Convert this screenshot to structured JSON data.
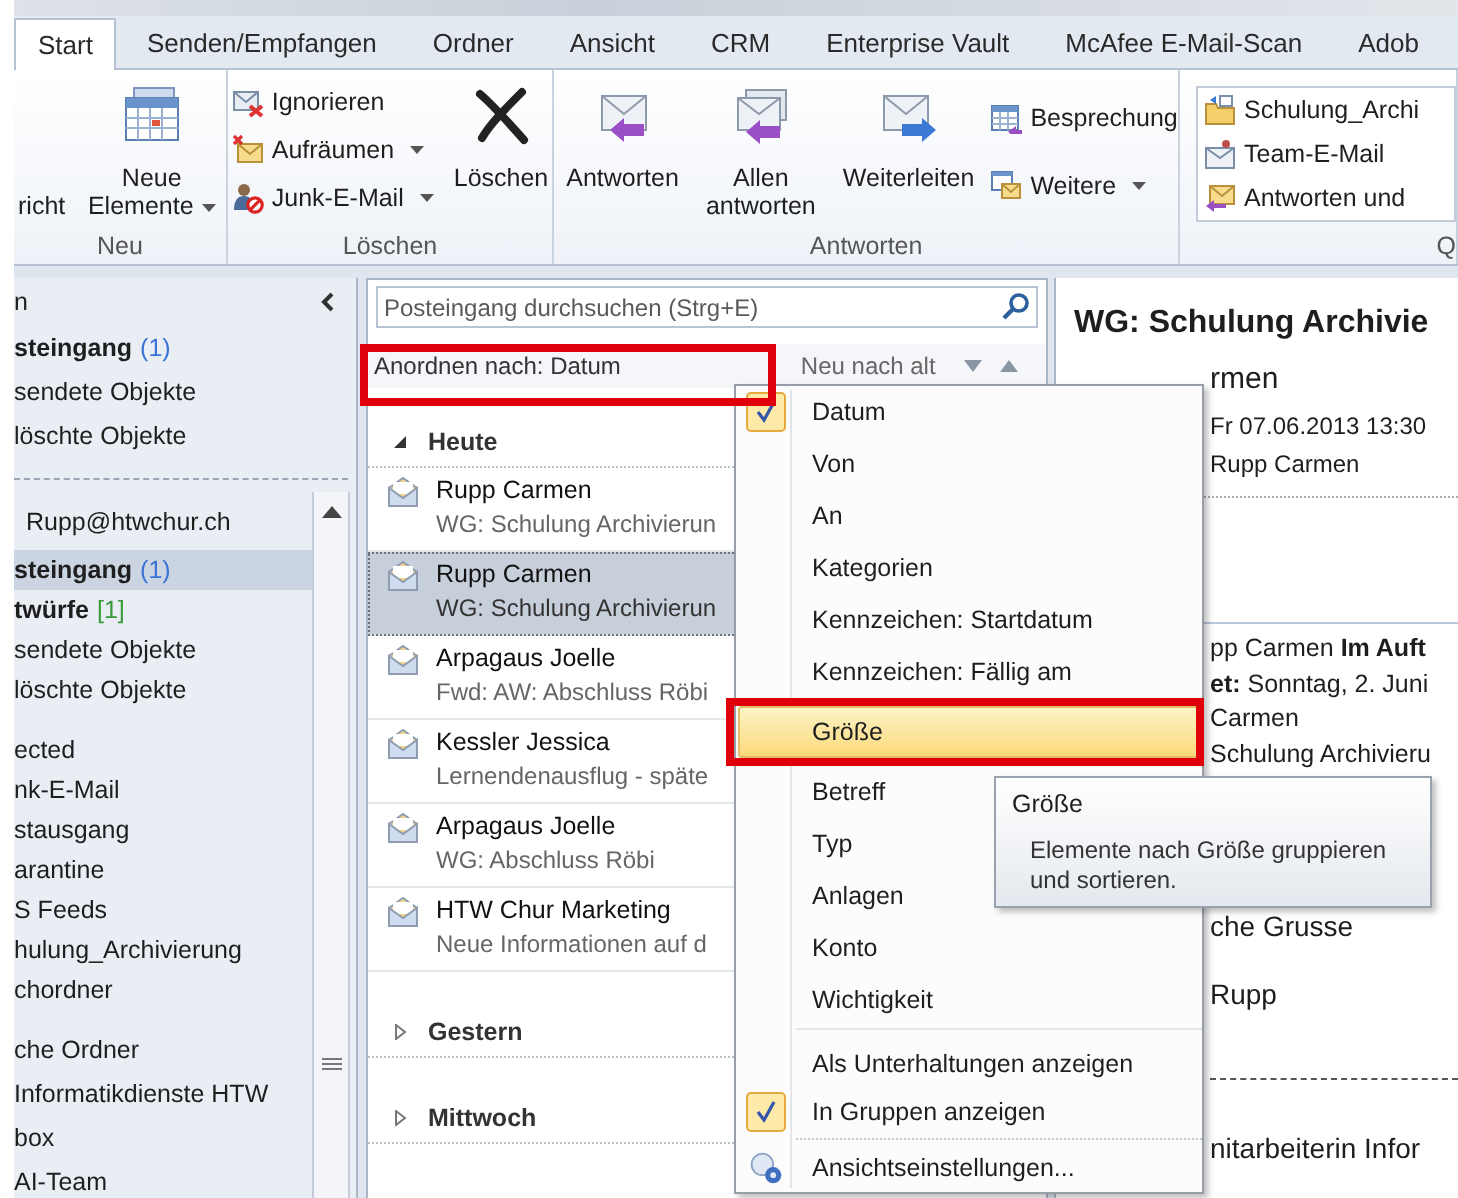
{
  "ribbon": {
    "tabs": [
      {
        "label": "Start",
        "selected": true
      },
      {
        "label": "Senden/Empfangen",
        "selected": false
      },
      {
        "label": "Ordner",
        "selected": false
      },
      {
        "label": "Ansicht",
        "selected": false
      },
      {
        "label": "CRM",
        "selected": false
      },
      {
        "label": "Enterprise Vault",
        "selected": false
      },
      {
        "label": "McAfee E-Mail-Scan",
        "selected": false
      },
      {
        "label": "Adob",
        "selected": false
      }
    ],
    "groups": [
      {
        "kind": "new",
        "label": "Neu",
        "large": [
          {
            "label": "richt",
            "dropdown": false
          },
          {
            "label": "Neue Elemente",
            "dropdown": true
          }
        ]
      },
      {
        "kind": "delete",
        "label": "Löschen",
        "small": [
          {
            "label": "Ignorieren",
            "dropdown": false
          },
          {
            "label": "Aufräumen",
            "dropdown": true
          },
          {
            "label": "Junk-E-Mail",
            "dropdown": true
          }
        ],
        "large": [
          {
            "label": "Löschen",
            "dropdown": false
          }
        ]
      },
      {
        "kind": "respond",
        "label": "Antworten",
        "large": [
          {
            "label": "Antworten",
            "dropdown": false
          },
          {
            "label": "Allen antworten",
            "dropdown": false
          },
          {
            "label": "Weiterleiten",
            "dropdown": false
          }
        ],
        "small": [
          {
            "label": "Besprechung",
            "dropdown": false
          },
          {
            "label": "Weitere",
            "dropdown": true
          }
        ]
      },
      {
        "kind": "quicksteps",
        "label": "Q",
        "small": [
          {
            "label": "Schulung_Archi",
            "dropdown": false
          },
          {
            "label": "Team-E-Mail",
            "dropdown": false
          },
          {
            "label": "Antworten und",
            "dropdown": false
          }
        ]
      }
    ]
  },
  "navigation": {
    "favorites": {
      "title": "n",
      "folders": [
        {
          "label": "steingang",
          "count": {
            "text": "(1)",
            "color": "#3b73d6"
          },
          "bold": true,
          "selected": false
        },
        {
          "label": "sendete Objekte",
          "bold": false,
          "selected": false
        },
        {
          "label": "löschte Objekte",
          "bold": false,
          "selected": false
        }
      ]
    },
    "mailbox": {
      "title": "Rupp@htwchur.ch",
      "groups": [
        {
          "folders": [
            {
              "label": "steingang",
              "count": {
                "text": "(1)",
                "color": "#3b73d6"
              },
              "bold": true,
              "selected": true
            },
            {
              "label": "twürfe",
              "count": {
                "text": "[1]",
                "color": "#3a9a3a"
              },
              "bold": true,
              "selected": false
            },
            {
              "label": "sendete Objekte",
              "bold": false,
              "selected": false
            },
            {
              "label": "löschte Objekte",
              "bold": false,
              "selected": false
            }
          ]
        },
        {
          "folders": [
            {
              "label": "ected",
              "bold": false,
              "selected": false
            },
            {
              "label": "nk-E-Mail",
              "bold": false,
              "selected": false
            },
            {
              "label": "stausgang",
              "bold": false,
              "selected": false
            },
            {
              "label": "arantine",
              "bold": false,
              "selected": false
            },
            {
              "label": "S Feeds",
              "bold": false,
              "selected": false
            },
            {
              "label": "hulung_Archivierung",
              "bold": false,
              "selected": false
            },
            {
              "label": "chordner",
              "bold": false,
              "selected": false
            }
          ]
        },
        {
          "folders": [
            {
              "label": "che Ordner",
              "bold": false,
              "selected": false
            },
            {
              "label": "Informatikdienste HTW",
              "bold": false,
              "selected": false
            },
            {
              "label": "box",
              "bold": false,
              "selected": false
            },
            {
              "label": "AI-Team",
              "bold": false,
              "selected": false
            }
          ]
        }
      ]
    }
  },
  "message_list": {
    "search": {
      "placeholder": "Posteingang durchsuchen (Strg+E)"
    },
    "arrange": {
      "label": "Anordnen nach: Datum",
      "order": "Neu nach alt"
    },
    "groups": [
      {
        "label": "Heute",
        "expanded": true,
        "messages": [
          {
            "sender": "Rupp Carmen",
            "subject": "WG: Schulung Archivierun",
            "selected": false
          },
          {
            "sender": "Rupp Carmen",
            "subject": "WG: Schulung Archivierun",
            "selected": true
          },
          {
            "sender": "Arpagaus Joelle",
            "subject": "Fwd: AW: Abschluss Röbi",
            "selected": false
          },
          {
            "sender": "Kessler Jessica",
            "subject": "Lernendenausflug - späte",
            "selected": false
          },
          {
            "sender": "Arpagaus Joelle",
            "subject": "WG: Abschluss Röbi",
            "selected": false
          },
          {
            "sender": "HTW Chur Marketing",
            "subject": "Neue Informationen auf d",
            "selected": false
          }
        ]
      },
      {
        "label": "Gestern",
        "expanded": false
      },
      {
        "label": "Mittwoch",
        "expanded": false
      }
    ]
  },
  "reading_pane": {
    "subject": "WG: Schulung Archivie",
    "sender": "rmen",
    "sent": "Fr 07.06.2013 13:30",
    "recipient": "Rupp Carmen",
    "forward_header": [
      "pp Carmen **Im Auft**",
      "**et:** Sonntag, 2. Juni",
      "Carmen",
      "Schulung Archivieru"
    ],
    "body": [
      {
        "kind": "text",
        "text": "che Grusse"
      },
      {
        "kind": "text",
        "text": "Rupp"
      },
      {
        "kind": "rule"
      },
      {
        "kind": "text",
        "text": "nitarbeiterin Infor"
      }
    ]
  },
  "arrange_menu": {
    "items": [
      {
        "label": "Datum",
        "kind": "option",
        "checked": true,
        "selected": false
      },
      {
        "label": "Von",
        "kind": "option",
        "checked": false,
        "selected": false
      },
      {
        "label": "An",
        "kind": "option",
        "checked": false,
        "selected": false
      },
      {
        "label": "Kategorien",
        "kind": "option",
        "checked": false,
        "selected": false
      },
      {
        "label": "Kennzeichen: Startdatum",
        "kind": "option",
        "checked": false,
        "selected": false
      },
      {
        "label": "Kennzeichen: Fällig am",
        "kind": "option",
        "checked": false,
        "selected": false
      },
      {
        "label": "Größe",
        "kind": "option",
        "checked": false,
        "selected": true
      },
      {
        "label": "Betreff",
        "kind": "option",
        "checked": false,
        "selected": false
      },
      {
        "label": "Typ",
        "kind": "option",
        "checked": false,
        "selected": false
      },
      {
        "label": "Anlagen",
        "kind": "option",
        "checked": false,
        "selected": false
      },
      {
        "label": "Konto",
        "kind": "option",
        "checked": false,
        "selected": false
      },
      {
        "label": "Wichtigkeit",
        "kind": "option",
        "checked": false,
        "selected": false
      },
      {
        "label": "Als Unterhaltungen anzeigen",
        "kind": "toggle",
        "checked": false,
        "selected": false
      },
      {
        "label": "In Gruppen anzeigen",
        "kind": "toggle",
        "checked": true,
        "selected": false
      },
      {
        "label": "Ansichtseinstellungen...",
        "kind": "command",
        "checked": false,
        "selected": false
      }
    ]
  },
  "tooltip": {
    "title": "Größe",
    "text": "Elemente nach Größe gruppieren und sortieren."
  }
}
